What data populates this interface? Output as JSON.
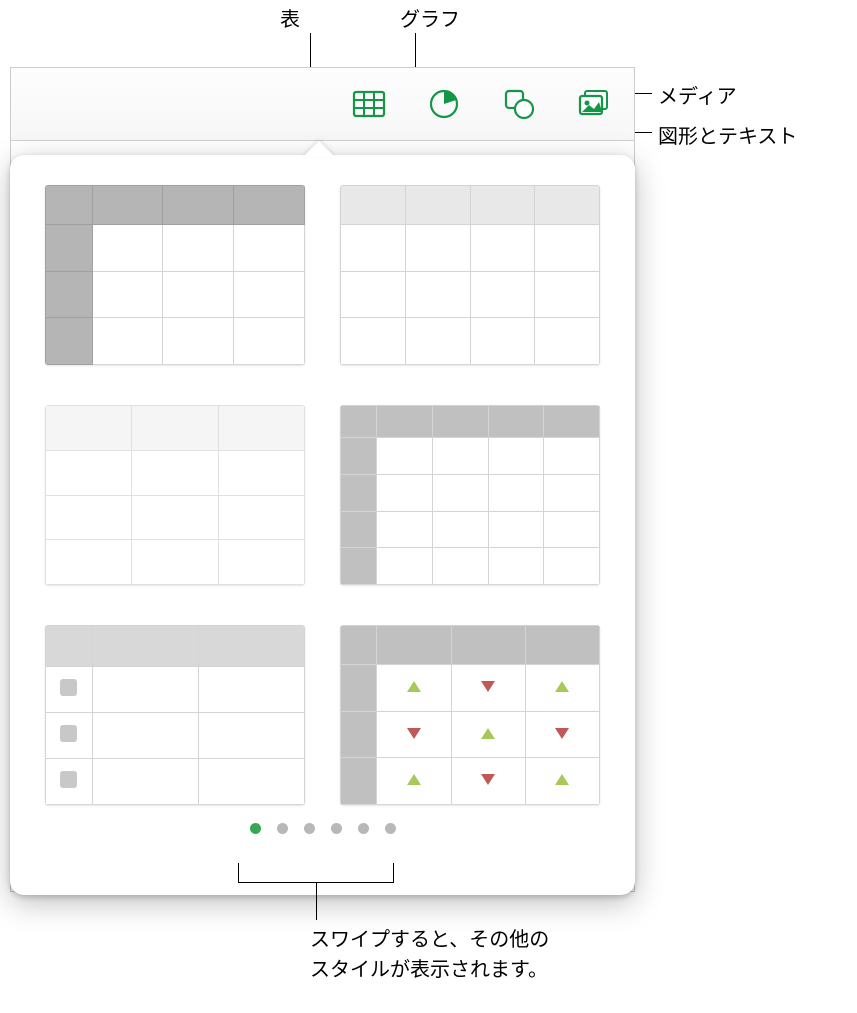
{
  "labels": {
    "table": "表",
    "chart": "グラフ",
    "media": "メディア",
    "shape_text": "図形とテキスト",
    "swipe_caption_line1": "スワイプすると、その他の",
    "swipe_caption_line2": "スタイルが表示されます。"
  },
  "toolbar": {
    "table_icon": "table-icon",
    "chart_icon": "chart-icon",
    "shape_icon": "shape-icon",
    "media_icon": "media-icon"
  },
  "popover": {
    "page_count": 6,
    "active_page": 1,
    "styles": [
      {
        "id": "style-1",
        "desc": "header-and-column-shaded"
      },
      {
        "id": "style-2",
        "desc": "header-shaded-light"
      },
      {
        "id": "style-3",
        "desc": "minimal-light"
      },
      {
        "id": "style-4",
        "desc": "header-column-5col"
      },
      {
        "id": "style-5",
        "desc": "checkbox-rows"
      },
      {
        "id": "style-6",
        "desc": "trend-arrows"
      }
    ]
  },
  "colors": {
    "accent": "#149648",
    "up_arrow": "#a6c957",
    "down_arrow": "#c15858"
  }
}
